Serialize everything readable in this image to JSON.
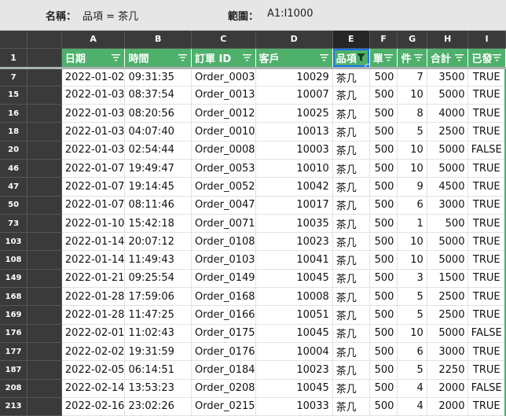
{
  "named_range": {
    "label": "名稱：",
    "value": "品項 = 茶几"
  },
  "range": {
    "label": "範圍：",
    "value": "A1:I1000"
  },
  "columns": [
    "A",
    "B",
    "C",
    "D",
    "E",
    "F",
    "G",
    "H",
    "I"
  ],
  "header_row_number": "1",
  "headers": [
    "日期",
    "時間",
    "訂單 ID",
    "客戶",
    "品項",
    "單",
    "件",
    "合計",
    "已發"
  ],
  "rows": [
    {
      "n": "7",
      "c": [
        "2022-01-02",
        "09:31:35",
        "Order_0003",
        "10029",
        "茶几",
        "500",
        "7",
        "3500",
        "TRUE"
      ]
    },
    {
      "n": "15",
      "c": [
        "2022-01-03",
        "08:37:54",
        "Order_0013",
        "10007",
        "茶几",
        "500",
        "10",
        "5000",
        "TRUE"
      ]
    },
    {
      "n": "16",
      "c": [
        "2022-01-03",
        "08:20:56",
        "Order_0012",
        "10025",
        "茶几",
        "500",
        "8",
        "4000",
        "TRUE"
      ]
    },
    {
      "n": "18",
      "c": [
        "2022-01-03",
        "04:07:40",
        "Order_0010",
        "10013",
        "茶几",
        "500",
        "5",
        "2500",
        "TRUE"
      ]
    },
    {
      "n": "20",
      "c": [
        "2022-01-03",
        "02:54:44",
        "Order_0008",
        "10003",
        "茶几",
        "500",
        "10",
        "5000",
        "FALSE"
      ]
    },
    {
      "n": "46",
      "c": [
        "2022-01-07",
        "19:49:47",
        "Order_0053",
        "10010",
        "茶几",
        "500",
        "10",
        "5000",
        "TRUE"
      ]
    },
    {
      "n": "47",
      "c": [
        "2022-01-07",
        "19:14:45",
        "Order_0052",
        "10042",
        "茶几",
        "500",
        "9",
        "4500",
        "TRUE"
      ]
    },
    {
      "n": "50",
      "c": [
        "2022-01-07",
        "08:11:46",
        "Order_0047",
        "10017",
        "茶几",
        "500",
        "6",
        "3000",
        "TRUE"
      ]
    },
    {
      "n": "73",
      "c": [
        "2022-01-10",
        "15:42:18",
        "Order_0071",
        "10035",
        "茶几",
        "500",
        "1",
        "500",
        "TRUE"
      ]
    },
    {
      "n": "103",
      "c": [
        "2022-01-14",
        "20:07:12",
        "Order_0108",
        "10023",
        "茶几",
        "500",
        "10",
        "5000",
        "TRUE"
      ]
    },
    {
      "n": "108",
      "c": [
        "2022-01-14",
        "11:49:43",
        "Order_0103",
        "10041",
        "茶几",
        "500",
        "10",
        "5000",
        "TRUE"
      ]
    },
    {
      "n": "149",
      "c": [
        "2022-01-21",
        "09:25:54",
        "Order_0149",
        "10045",
        "茶几",
        "500",
        "3",
        "1500",
        "TRUE"
      ]
    },
    {
      "n": "168",
      "c": [
        "2022-01-28",
        "17:59:06",
        "Order_0168",
        "10008",
        "茶几",
        "500",
        "5",
        "2500",
        "TRUE"
      ]
    },
    {
      "n": "169",
      "c": [
        "2022-01-28",
        "11:47:25",
        "Order_0166",
        "10051",
        "茶几",
        "500",
        "5",
        "2500",
        "TRUE"
      ]
    },
    {
      "n": "176",
      "c": [
        "2022-02-01",
        "11:02:43",
        "Order_0175",
        "10045",
        "茶几",
        "500",
        "10",
        "5000",
        "FALSE"
      ]
    },
    {
      "n": "177",
      "c": [
        "2022-02-02",
        "19:31:59",
        "Order_0176",
        "10004",
        "茶几",
        "500",
        "6",
        "3000",
        "TRUE"
      ]
    },
    {
      "n": "187",
      "c": [
        "2022-02-05",
        "06:14:51",
        "Order_0184",
        "10023",
        "茶几",
        "500",
        "5",
        "2250",
        "TRUE"
      ]
    },
    {
      "n": "208",
      "c": [
        "2022-02-14",
        "13:53:23",
        "Order_0208",
        "10045",
        "茶几",
        "500",
        "4",
        "2000",
        "FALSE"
      ]
    },
    {
      "n": "213",
      "c": [
        "2022-02-16",
        "23:02:26",
        "Order_0215",
        "10033",
        "茶几",
        "500",
        "4",
        "2000",
        "TRUE"
      ]
    }
  ],
  "colors": {
    "header_green": "#4eb06b",
    "header_dark": "#3a3a3a",
    "selection_blue": "#1a73e8"
  },
  "icons": {
    "filter": "filter-icon",
    "active_filter": "filter-active-icon"
  }
}
